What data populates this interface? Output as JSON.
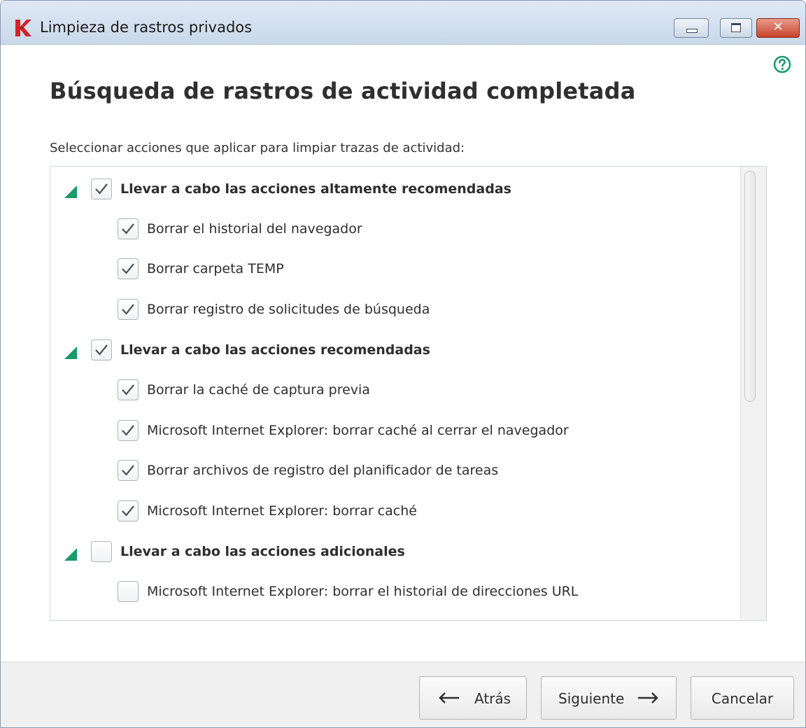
{
  "window": {
    "title": "Limpieza de rastros privados",
    "logo_icon": "kaspersky-logo-icon",
    "controls": [
      "minimize-icon",
      "maximize-icon",
      "close-icon"
    ],
    "close_glyph": "✕"
  },
  "help_icon": "help-icon",
  "heading": "Búsqueda de rastros de actividad completada",
  "instruction": "Seleccionar acciones que aplicar para limpiar trazas de actividad:",
  "colors": {
    "accent": "#1b9a6b",
    "close": "#c6442c"
  },
  "groups": [
    {
      "label": "Llevar a cabo las acciones altamente recomendadas",
      "checked": true,
      "expanded": true,
      "items": [
        {
          "label": "Borrar el historial del navegador",
          "checked": true
        },
        {
          "label": "Borrar carpeta TEMP",
          "checked": true
        },
        {
          "label": "Borrar registro de solicitudes de búsqueda",
          "checked": true
        }
      ]
    },
    {
      "label": "Llevar a cabo las acciones recomendadas",
      "checked": true,
      "expanded": true,
      "items": [
        {
          "label": "Borrar la caché de captura previa",
          "checked": true
        },
        {
          "label": "Microsoft Internet Explorer: borrar caché al cerrar el navegador",
          "checked": true
        },
        {
          "label": "Borrar archivos de registro del planificador de tareas",
          "checked": true
        },
        {
          "label": "Microsoft Internet Explorer: borrar caché",
          "checked": true
        }
      ]
    },
    {
      "label": "Llevar a cabo las acciones adicionales",
      "checked": false,
      "expanded": true,
      "items": [
        {
          "label": "Microsoft Internet Explorer: borrar el historial de direcciones URL",
          "checked": false
        }
      ]
    }
  ],
  "buttons": {
    "back": {
      "label": "Atrás",
      "icon": "arrow-left-icon"
    },
    "next": {
      "label": "Siguiente",
      "icon": "arrow-right-icon"
    },
    "cancel": {
      "label": "Cancelar"
    }
  }
}
